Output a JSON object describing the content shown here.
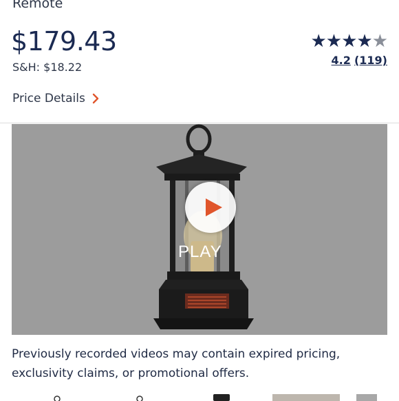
{
  "product": {
    "title": "Remote",
    "price": "$179.43",
    "shipping": "S&H: $18.22",
    "rating_value": "4.2",
    "rating_count": "(119)",
    "stars": "★★★★",
    "star_partial": "★",
    "price_details_label": "Price Details"
  },
  "video": {
    "play_label": "PLAY",
    "disclaimer": "Previously recorded videos may contain expired pricing, exclusivity claims, or promotional offers."
  },
  "colors": {
    "brand_navy": "#1b2a52",
    "accent_orange": "#e0552b",
    "video_bg": "#9c9c9c"
  }
}
